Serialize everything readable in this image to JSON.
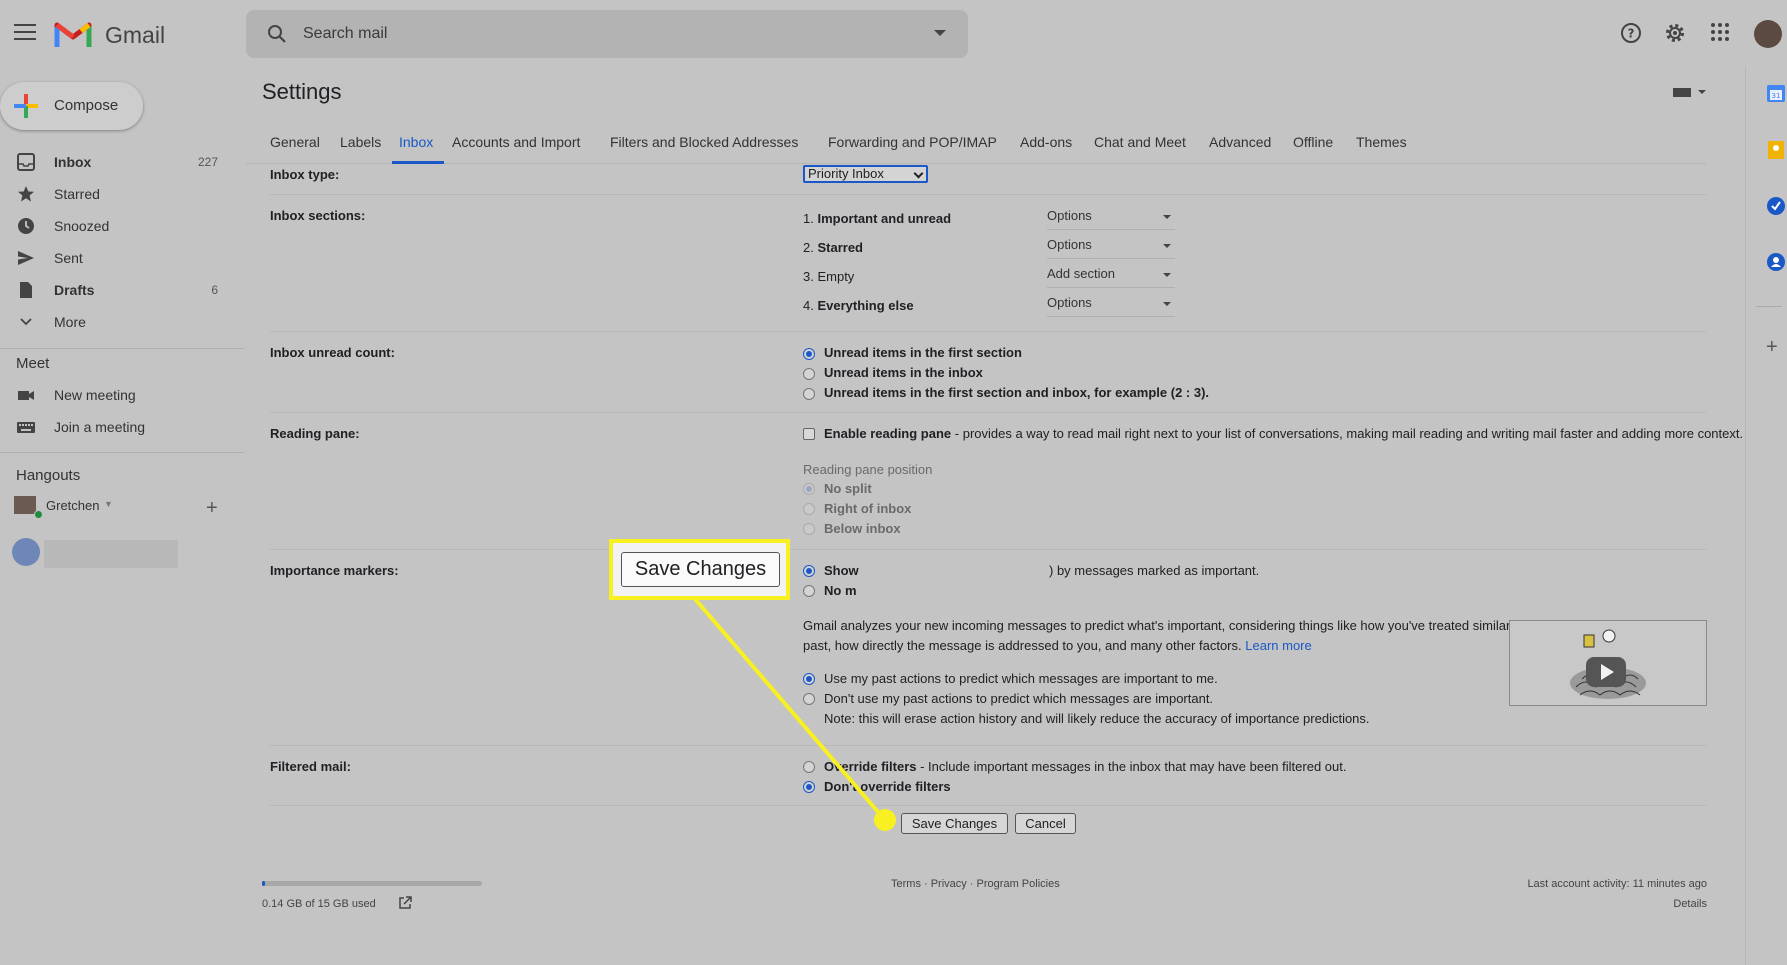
{
  "app": {
    "brand": "Gmail"
  },
  "search": {
    "placeholder": "Search mail"
  },
  "compose_label": "Compose",
  "nav": [
    {
      "label": "Inbox",
      "count": "227",
      "bold": true
    },
    {
      "label": "Starred",
      "count": ""
    },
    {
      "label": "Snoozed",
      "count": ""
    },
    {
      "label": "Sent",
      "count": ""
    },
    {
      "label": "Drafts",
      "count": "6",
      "bold": true
    },
    {
      "label": "More",
      "count": ""
    }
  ],
  "meet": {
    "heading": "Meet",
    "new_meeting": "New meeting",
    "join_meeting": "Join a meeting"
  },
  "hangouts": {
    "heading": "Hangouts",
    "user": "Gretchen"
  },
  "settings": {
    "title": "Settings",
    "tabs": [
      "General",
      "Labels",
      "Inbox",
      "Accounts and Import",
      "Filters and Blocked Addresses",
      "Forwarding and POP/IMAP",
      "Add-ons",
      "Chat and Meet",
      "Advanced",
      "Offline",
      "Themes"
    ],
    "active_tab": "Inbox",
    "inbox_type": {
      "label": "Inbox type:",
      "value": "Priority Inbox"
    },
    "inbox_sections": {
      "label": "Inbox sections:",
      "items": [
        {
          "num": "1.",
          "name": "Important and unread",
          "action": "Options"
        },
        {
          "num": "2.",
          "name": "Starred",
          "action": "Options"
        },
        {
          "num": "3.",
          "name": "Empty",
          "action": "Add section"
        },
        {
          "num": "4.",
          "name": "Everything else",
          "action": "Options"
        }
      ]
    },
    "unread_count": {
      "label": "Inbox unread count:",
      "options": [
        "Unread items in the first section",
        "Unread items in the inbox",
        "Unread items in the first section and inbox, for example (2 : 3)."
      ]
    },
    "reading_pane": {
      "label": "Reading pane:",
      "enable": "Enable reading pane",
      "desc": " - provides a way to read mail right next to your list of conversations, making mail reading and writing mail faster and adding more context.",
      "position_label": "Reading pane position",
      "positions": [
        "No split",
        "Right of inbox",
        "Below inbox"
      ]
    },
    "importance": {
      "label": "Importance markers:",
      "show": "Show",
      "show_suffix": ") by messages marked as important.",
      "no": "No m",
      "desc1": "Gmail analyzes your new incoming messages to predict what's important, considering things like how you've treated similar messages in the",
      "desc2": "past, how directly the message is addressed to you, and many other factors.",
      "learn_more": "Learn more",
      "use_past": "Use my past actions to predict which messages are important to me.",
      "dont_use": "Don't use my past actions to predict which messages are important.",
      "note": "Note: this will erase action history and will likely reduce the accuracy of importance predictions."
    },
    "filtered": {
      "label": "Filtered mail:",
      "override": "Override filters",
      "override_desc": " - Include important messages in the inbox that may have been filtered out.",
      "dont_override": "Don't override filters"
    },
    "save": "Save Changes",
    "cancel": "Cancel"
  },
  "footer": {
    "storage": "0.14 GB of 15 GB used",
    "storage_fraction": 0.009,
    "links": "Terms · Privacy · Program Policies",
    "activity": "Last account activity: 11 minutes ago",
    "details": "Details"
  },
  "callout": {
    "label": "Save Changes"
  },
  "colors": {
    "accent": "#1a58c7",
    "highlight": "#f8f020"
  }
}
